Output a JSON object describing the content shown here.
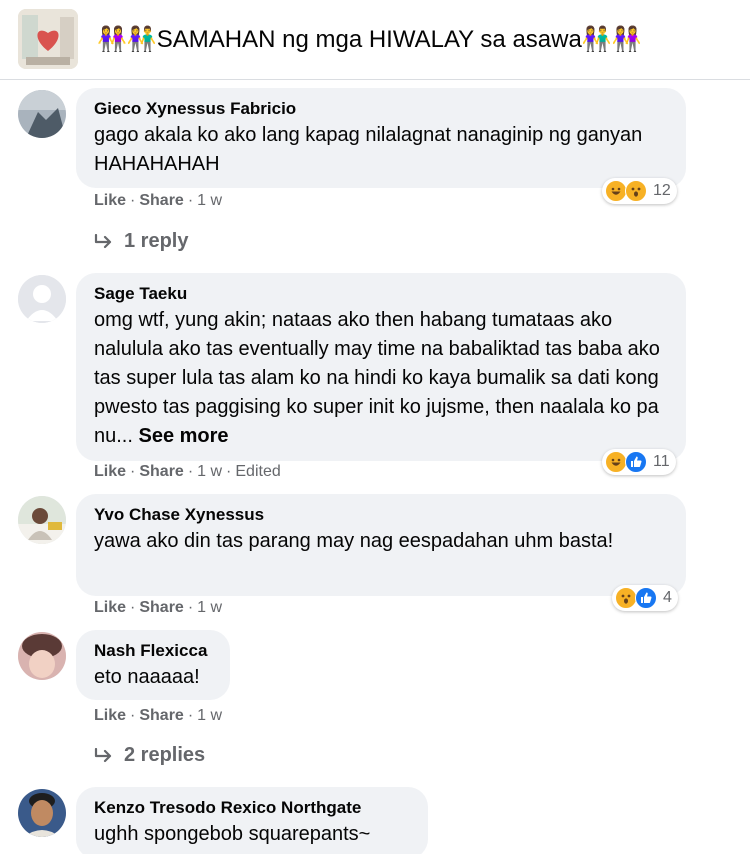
{
  "group": {
    "title": "👭👫SAMAHAN ng mga HIWALAY sa asawa👫👭"
  },
  "comments": [
    {
      "author": "Gieco Xynessus Fabricio",
      "text": "gago akala ko ako lang kapag nilalagnat nanaginip ng ganyan HAHAHAHAH",
      "like": "Like",
      "share": "Share",
      "time": "1 w",
      "reactions": [
        "haha",
        "wow"
      ],
      "reaction_count": "12",
      "replies": "1 reply"
    },
    {
      "author": "Sage Taeku",
      "text": "omg wtf, yung akin; nataas ako then habang tumataas ako nalulula ako tas eventually may time na babaliktad tas baba ako tas super lula tas alam ko na hindi ko kaya bumalik sa dati kong pwesto tas paggising ko super init ko jujsme, then naalala ko pa nu...",
      "see_more": "See more",
      "like": "Like",
      "share": "Share",
      "time": "1 w",
      "edited": "Edited",
      "reactions": [
        "haha",
        "like"
      ],
      "reaction_count": "11"
    },
    {
      "author": "Yvo Chase Xynessus",
      "text": "yawa ako din tas parang may nag eespadahan uhm basta!",
      "like": "Like",
      "share": "Share",
      "time": "1 w",
      "reactions": [
        "wow",
        "like"
      ],
      "reaction_count": "4"
    },
    {
      "author": "Nash Flexicca",
      "text": "eto naaaaa!",
      "like": "Like",
      "share": "Share",
      "time": "1 w",
      "replies": "2 replies"
    },
    {
      "author": "Kenzo Tresodo Rexico Northgate",
      "text": "ughh spongebob squarepants~"
    }
  ],
  "colors": {
    "bubble": "#f0f2f5",
    "secondary_text": "#65676b",
    "like_blue": "#1877f2",
    "emoji_yellow": "#f7b125"
  }
}
